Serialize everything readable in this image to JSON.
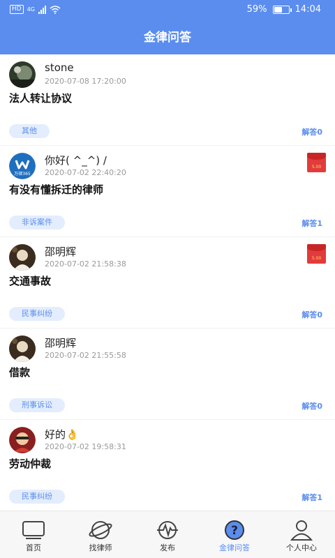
{
  "status_bar": {
    "hd": "HD",
    "network": "4G",
    "battery_percent": "59%",
    "battery_level": 0.59,
    "time": "14:04"
  },
  "header": {
    "title": "金律问答"
  },
  "posts": [
    {
      "username": "stone",
      "time": "2020-07-08 17:20:00",
      "title": "法人转让协议",
      "tag": "其他",
      "answers": "解答0",
      "has_red_packet": false
    },
    {
      "username": "你好( ^_^) /",
      "time": "2020-07-02 22:40:20",
      "title": "有没有懂拆迁的律师",
      "tag": "非诉案件",
      "answers": "解答1",
      "has_red_packet": true,
      "red_packet_amount": "5.00",
      "avatar_text": "万律365"
    },
    {
      "username": "邵明辉",
      "time": "2020-07-02 21:58:38",
      "title": "交通事故",
      "tag": "民事纠纷",
      "answers": "解答0",
      "has_red_packet": true,
      "red_packet_amount": "5.00"
    },
    {
      "username": "邵明辉",
      "time": "2020-07-02 21:55:58",
      "title": "借款",
      "tag": "刑事诉讼",
      "answers": "解答0",
      "has_red_packet": false
    },
    {
      "username": "好的👌",
      "time": "2020-07-02 19:58:31",
      "title": "劳动仲裁",
      "tag": "民事纠纷",
      "answers": "解答1",
      "has_red_packet": false
    }
  ],
  "tabs": [
    {
      "label": "首页",
      "icon": "home-icon"
    },
    {
      "label": "找律师",
      "icon": "planet-icon"
    },
    {
      "label": "发布",
      "icon": "publish-icon"
    },
    {
      "label": "金律问答",
      "icon": "question-icon",
      "active": true
    },
    {
      "label": "个人中心",
      "icon": "person-icon"
    }
  ],
  "colors": {
    "primary": "#5b8def",
    "tag_bg": "#e3edfd",
    "red_packet": "#e23b3b"
  }
}
